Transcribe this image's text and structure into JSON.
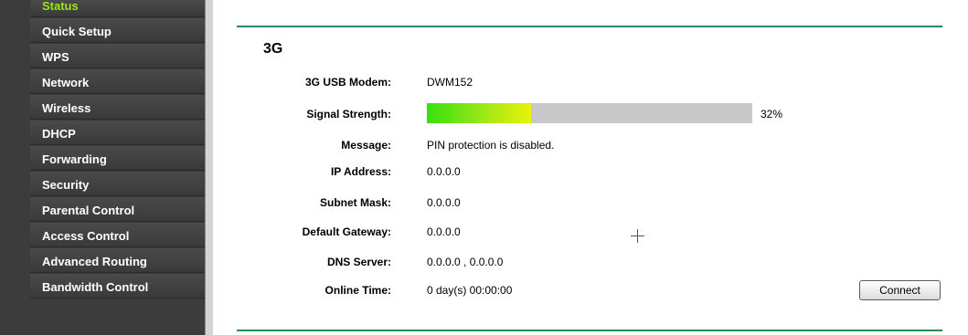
{
  "sidebar": {
    "items": [
      {
        "label": "Status"
      },
      {
        "label": "Quick Setup"
      },
      {
        "label": "WPS"
      },
      {
        "label": "Network"
      },
      {
        "label": "Wireless"
      },
      {
        "label": "DHCP"
      },
      {
        "label": "Forwarding"
      },
      {
        "label": "Security"
      },
      {
        "label": "Parental Control"
      },
      {
        "label": "Access Control"
      },
      {
        "label": "Advanced Routing"
      },
      {
        "label": "Bandwidth Control"
      }
    ],
    "active_color": "#9ae81a"
  },
  "section": {
    "title": "3G"
  },
  "fields": {
    "modem": {
      "label": "3G USB Modem:",
      "value": "DWM152"
    },
    "signal": {
      "label": "Signal Strength:",
      "percent_text": "32%",
      "percent": 32
    },
    "message": {
      "label": "Message:",
      "value": "PIN protection is disabled."
    },
    "ip": {
      "label": "IP Address:",
      "value": "0.0.0.0"
    },
    "subnet": {
      "label": "Subnet Mask:",
      "value": "0.0.0.0"
    },
    "gateway": {
      "label": "Default Gateway:",
      "value": "0.0.0.0"
    },
    "dns": {
      "label": "DNS Server:",
      "value": "0.0.0.0 , 0.0.0.0"
    },
    "online": {
      "label": "Online Time:",
      "value": "0 day(s) 00:00:00"
    }
  },
  "actions": {
    "connect_label": "Connect"
  },
  "colors": {
    "divider": "#2c8a56",
    "sidebar_bg": "#3c3c3c"
  }
}
